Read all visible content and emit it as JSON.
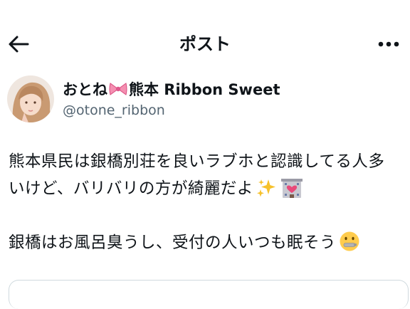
{
  "header": {
    "title": "ポスト",
    "back_icon": "arrow-left-icon",
    "more_icon": "more-horizontal-icon"
  },
  "author": {
    "name_prefix": "おとね",
    "name_emoji": "ribbon-emoji",
    "name_suffix": "熊本 Ribbon Sweet",
    "handle": "@otone_ribbon"
  },
  "tweet": {
    "line1": "熊本県民は銀橋別荘を良いラブホと認識してる人多",
    "line2": "いけど、バリバリの方が綺麗だよ",
    "line2_emojis": [
      "sparkles-emoji",
      "love-hotel-emoji"
    ],
    "line3": "銀橋はお風呂臭うし、受付の人いつも眠そう",
    "line3_emoji": "zipper-mouth-face-emoji"
  },
  "colors": {
    "text": "#0f1419",
    "secondary": "#536471",
    "border": "#cfd9de"
  }
}
